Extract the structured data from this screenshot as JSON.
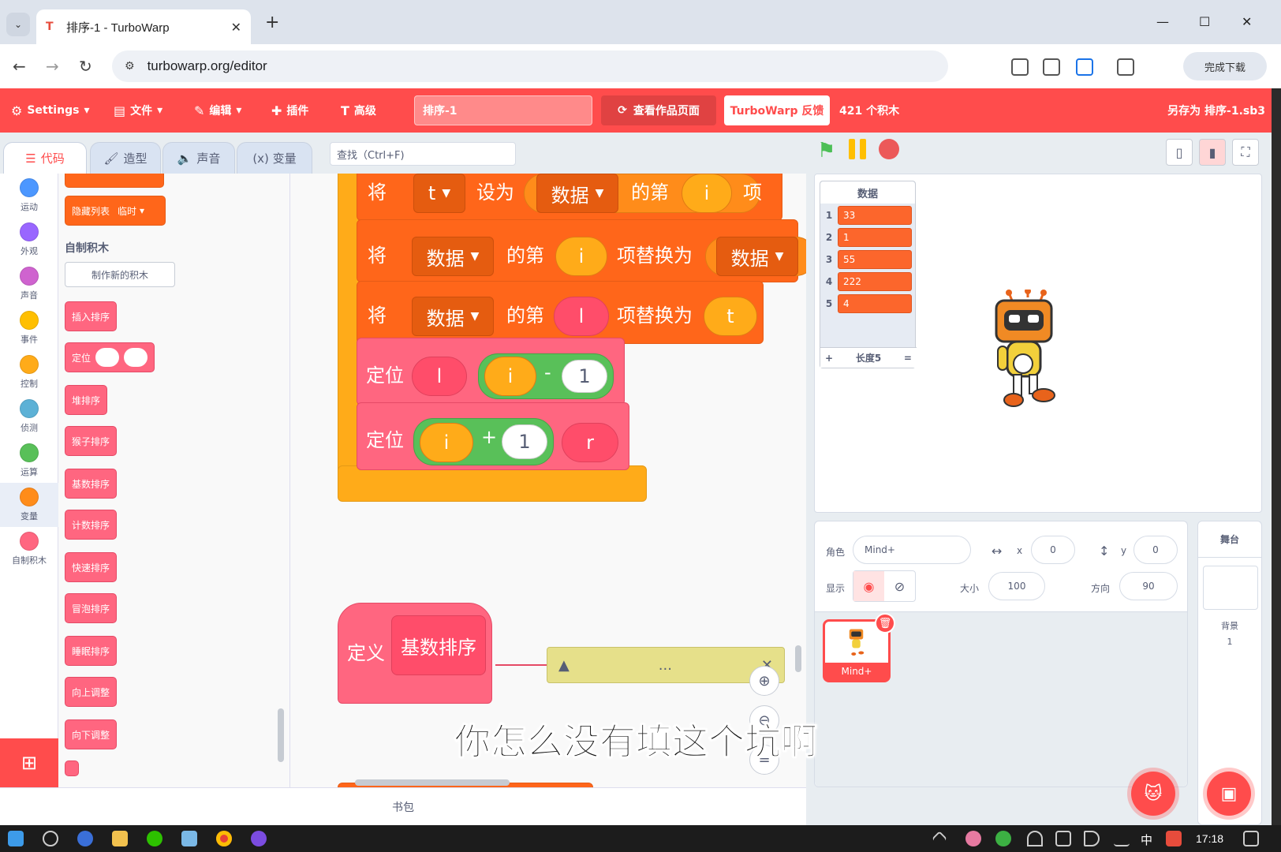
{
  "browser": {
    "tab_title": "排序-1 - TurboWarp",
    "url": "turbowarp.org/editor",
    "profile_label": "完成下载"
  },
  "menubar": {
    "settings": "Settings",
    "file": "文件",
    "edit": "编辑",
    "addons": "插件",
    "advanced": "高级",
    "project_title": "排序-1",
    "see_project": "查看作品页面",
    "feedback": "TurboWarp 反馈",
    "block_count": "421 个积木",
    "save_as": "另存为 排序-1.sb3"
  },
  "editor_tabs": {
    "code": "代码",
    "costumes": "造型",
    "sounds": "声音",
    "variables": "(x) 变量"
  },
  "find": {
    "placeholder": "查找（Ctrl+F)"
  },
  "categories": [
    {
      "label": "运动",
      "color": "#4c97ff"
    },
    {
      "label": "外观",
      "color": "#9966ff"
    },
    {
      "label": "声音",
      "color": "#cf63cf"
    },
    {
      "label": "事件",
      "color": "#ffbf00"
    },
    {
      "label": "控制",
      "color": "#ffab19"
    },
    {
      "label": "侦测",
      "color": "#5cb1d6"
    },
    {
      "label": "运算",
      "color": "#59c059"
    },
    {
      "label": "变量",
      "color": "#ff8c1a"
    },
    {
      "label": "自制积木",
      "color": "#ff6680"
    }
  ],
  "palette": {
    "hide_list_block": "隐藏列表",
    "hide_list_option": "临时",
    "custom_heading": "自制积木",
    "make_block": "制作新的积木",
    "blocks": [
      "插入排序",
      "定位",
      "堆排序",
      "猴子排序",
      "基数排序",
      "计数排序",
      "快速排序",
      "冒泡排序",
      "睡眠排序",
      "向上调整",
      "向下调整"
    ]
  },
  "script": {
    "row1": {
      "set": "将",
      "var": "t",
      "to": "设为",
      "list": "数据",
      "item_of": "的第",
      "idx": "i",
      "item": "项"
    },
    "row2": {
      "set": "将",
      "list": "数据",
      "item_of": "的第",
      "idx": "i",
      "replace": "项替换为",
      "list2": "数据"
    },
    "row3": {
      "set": "将",
      "list": "数据",
      "item_of": "的第",
      "idx": "l",
      "replace": "项替换为",
      "val": "t"
    },
    "row4": {
      "call": "定位",
      "arg1": "l",
      "op_a": "i",
      "op": "-",
      "op_b": "1"
    },
    "row5": {
      "call": "定位",
      "op_a": "i",
      "op": "+",
      "op_b": "1",
      "arg2": "r"
    },
    "define": {
      "label": "定义",
      "name": "基数排序"
    },
    "comment": "..."
  },
  "backpack": "书包",
  "list_monitor": {
    "title": "数据",
    "items": [
      "33",
      "1",
      "55",
      "222",
      "4"
    ],
    "footer_add": "+",
    "footer_length": "长度5",
    "footer_resize": "="
  },
  "sprite_info": {
    "sprite_label": "角色",
    "sprite_name": "Mind+",
    "x_label": "x",
    "x": "0",
    "y_label": "y",
    "y": "0",
    "show_label": "显示",
    "size_label": "大小",
    "size": "100",
    "direction_label": "方向",
    "direction": "90"
  },
  "sprite_list": [
    {
      "name": "Mind+"
    }
  ],
  "stage_pane": {
    "title": "舞台",
    "backdrops_label": "背景",
    "backdrops_count": "1"
  },
  "subtitle": "你怎么没有填这个坑啊",
  "taskbar": {
    "ime": "中",
    "time": "17:18"
  }
}
